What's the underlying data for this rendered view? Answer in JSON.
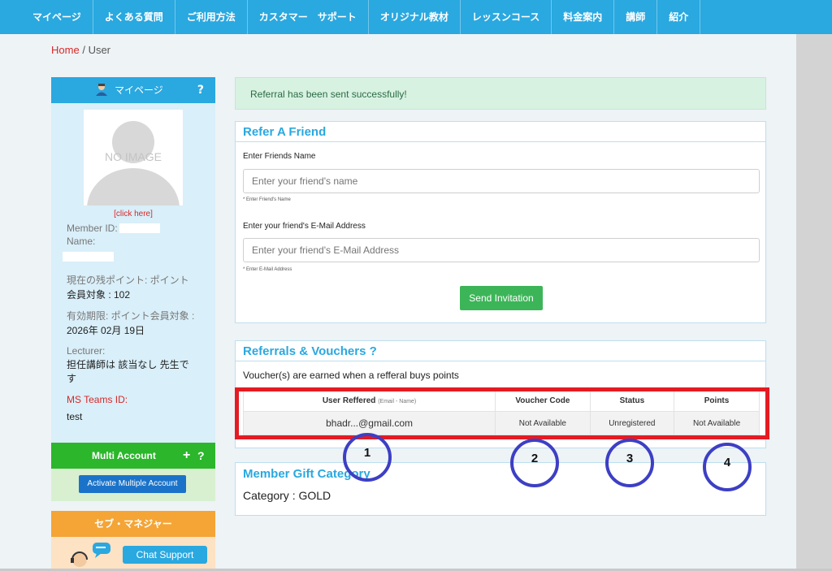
{
  "nav": [
    "マイページ",
    "よくある質問",
    "ご利用方法",
    "カスタマー　サポート",
    "オリジナル教材",
    "レッスンコース",
    "料金案内",
    "講師",
    "紹介"
  ],
  "breadcrumb": {
    "home": "Home",
    "sep": "/",
    "current": "User"
  },
  "sidebar": {
    "title": "マイページ",
    "help": "?",
    "no_image": "NO IMAGE",
    "click_here": "[click here]",
    "member_id_label": "Member ID:",
    "name_label": "Name:",
    "points_label": "現在の残ポイント: ポイント",
    "points_value": "会員対象 : 102",
    "expiry_label": "有効期限: ポイント会員対象 :",
    "expiry_value": "2026年 02月 19日",
    "lecturer_label": "Lecturer:",
    "lecturer_value": "担任講師は 該当なし 先生です",
    "teams_label": "MS Teams ID:",
    "teams_value": "test"
  },
  "multi_account": {
    "title": "Multi Account",
    "plus": "+",
    "help": "?",
    "button": "Activate Multiple Account"
  },
  "sev": {
    "title": "セブ・マネジャー",
    "chat_button": "Chat Support"
  },
  "alert": "Referral has been sent successfully!",
  "refer": {
    "title": "Refer A Friend",
    "name_label": "Enter Friends Name",
    "name_placeholder": "Enter your friend's name",
    "name_hint": "* Enter Friend's Name",
    "email_label": "Enter your friend's E-Mail Address",
    "email_placeholder": "Enter your friend's E-Mail Address",
    "email_hint": "* Enter E-Mail Address",
    "send_button": "Send Invitation"
  },
  "vouchers": {
    "title": "Referrals & Vouchers",
    "help": "?",
    "description": "Voucher(s) are earned when a refferal buys points",
    "headers": {
      "user": "User Reffered",
      "user_sub": "(Email - Name)",
      "code": "Voucher Code",
      "status": "Status",
      "points": "Points"
    },
    "rows": [
      {
        "user": "bhadr...@gmail.com",
        "code": "Not Available",
        "status": "Unregistered",
        "points": "Not Available"
      }
    ]
  },
  "gift": {
    "title": "Member Gift Category",
    "category": "Category : GOLD"
  },
  "annotations": [
    "1",
    "2",
    "3",
    "4"
  ],
  "colors": {
    "nav": "#2aa8e0",
    "highlight": "#e41b23",
    "circle": "#3d3fc4",
    "send": "#3cb558"
  }
}
